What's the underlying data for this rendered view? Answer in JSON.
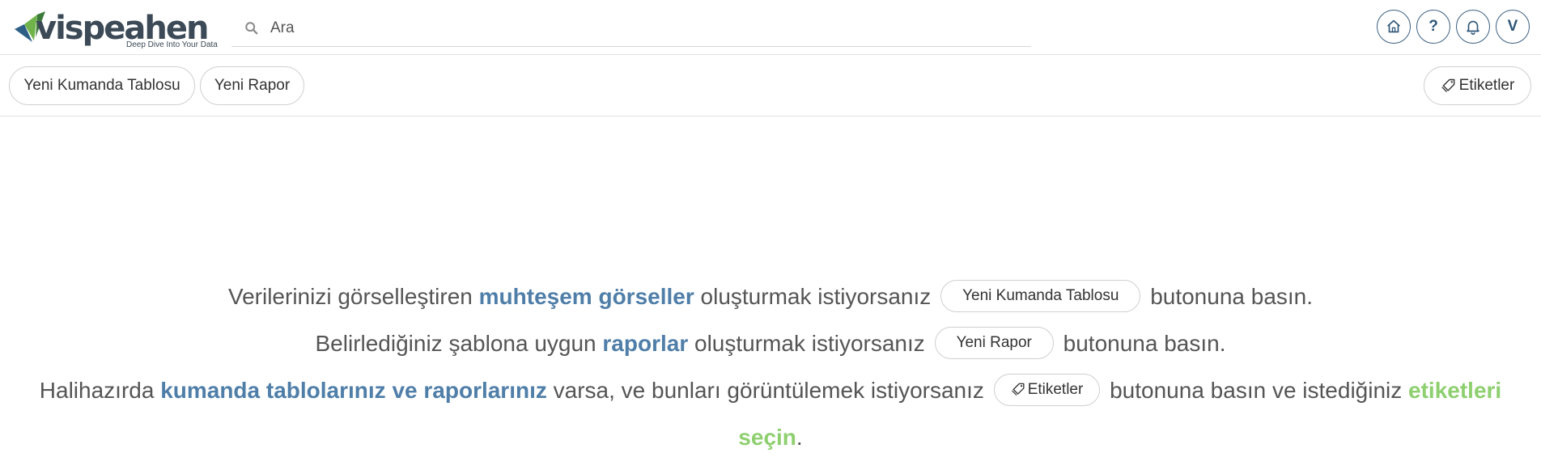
{
  "brand": {
    "name": "vispeahen",
    "tagline": "Deep Dive Into Your Data"
  },
  "search": {
    "placeholder": "Ara",
    "value": ""
  },
  "header_icons": [
    {
      "name": "home-icon"
    },
    {
      "name": "help-icon",
      "label": "?"
    },
    {
      "name": "bell-icon"
    },
    {
      "name": "user-avatar",
      "label": "V"
    }
  ],
  "toolbar": {
    "new_dashboard": "Yeni Kumanda Tablosu",
    "new_report": "Yeni Rapor",
    "tags": "Etiketler"
  },
  "message": {
    "line1": {
      "pre": "Verilerinizi görselleştiren ",
      "highlight": "muhteşem görseller",
      "mid": " oluşturmak istiyorsanız",
      "button": "Yeni Kumanda Tablosu",
      "post": "butonuna basın."
    },
    "line2": {
      "pre": "Belirlediğiniz şablona uygun ",
      "highlight": "raporlar",
      "mid": " oluşturmak istiyorsanız",
      "button": "Yeni Rapor",
      "post": "butonuna basın."
    },
    "line3": {
      "pre": "Halihazırda ",
      "highlight": "kumanda tablolarınız ve raporlarınız",
      "mid": " varsa, ve bunları görüntülemek istiyorsanız",
      "button": "Etiketler",
      "post": "butonuna basın ve istediğiniz ",
      "highlight_green": "etiketleri",
      "line4_green": "seçin",
      "line4_end": "."
    }
  },
  "colors": {
    "brand_dark": "#3c4a57",
    "brand_green": "#6fb34a",
    "accent_blue": "#4f7ea8",
    "accent_green": "#8ecf6f",
    "icon_blue": "#2e5677"
  }
}
